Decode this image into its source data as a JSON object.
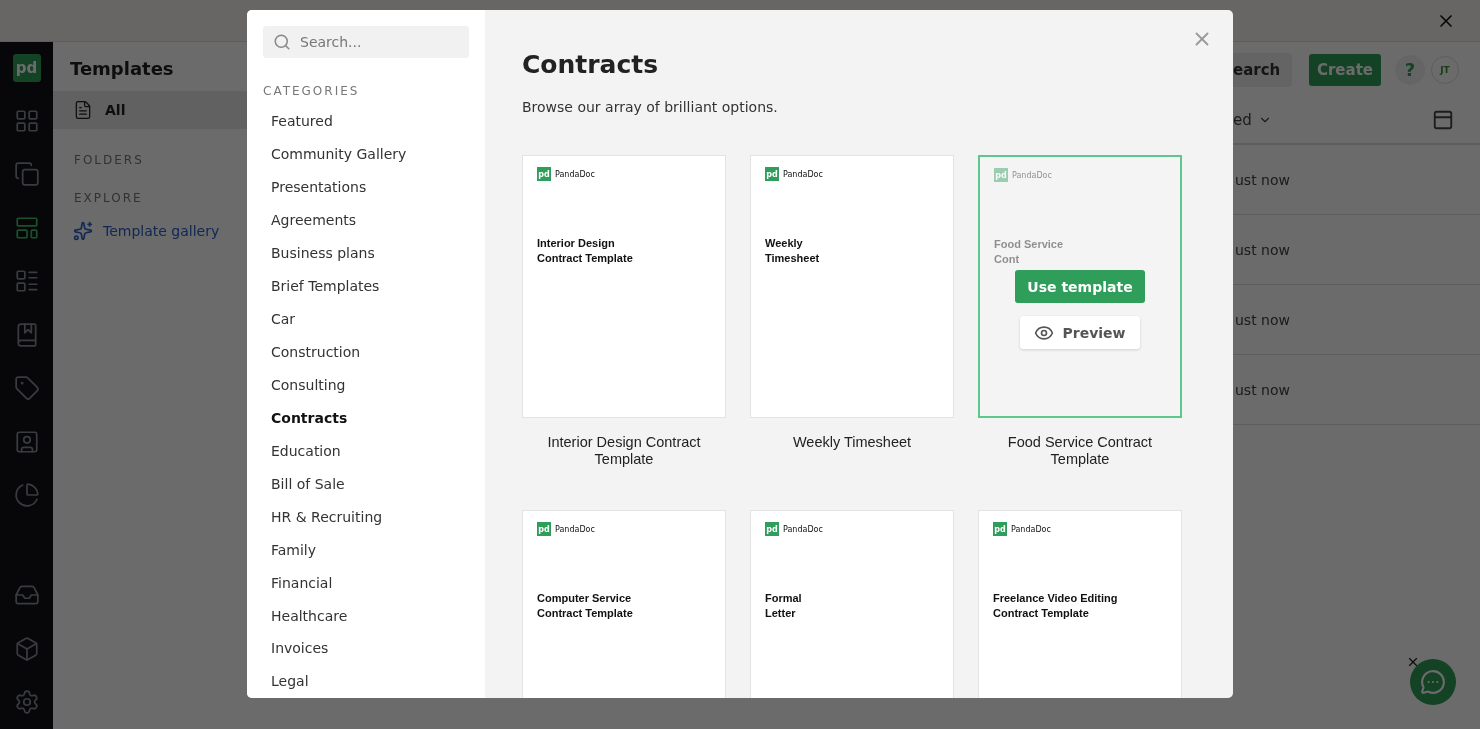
{
  "rail": {
    "logo": "pd",
    "items": [
      {
        "kind": "grid",
        "selected": false
      },
      {
        "kind": "documents",
        "selected": false
      },
      {
        "kind": "templates",
        "selected": true
      },
      {
        "kind": "layout",
        "selected": false
      },
      {
        "kind": "book",
        "selected": false
      },
      {
        "kind": "tag",
        "selected": false
      },
      {
        "kind": "contact",
        "selected": false
      },
      {
        "kind": "chart",
        "selected": false
      }
    ],
    "bottom_items": [
      {
        "kind": "inbox",
        "selected": false
      },
      {
        "kind": "cube",
        "selected": false
      },
      {
        "kind": "settings",
        "selected": false
      }
    ]
  },
  "sidebar": {
    "title": "Templates",
    "items": [
      {
        "label": "All",
        "selected": true
      }
    ],
    "sections": [
      {
        "heading": "FOLDERS"
      },
      {
        "heading": "EXPLORE",
        "links": [
          {
            "label": "Template gallery"
          }
        ]
      }
    ]
  },
  "toolbar": {
    "search_label": "earch",
    "create_label": "Create",
    "help_label": "?",
    "avatar": "JT",
    "sort_label": "ed"
  },
  "rows": [
    {
      "modified": "ust now"
    },
    {
      "modified": "ust now"
    },
    {
      "modified": "ust now"
    },
    {
      "modified": "ust now"
    }
  ],
  "modal": {
    "search_placeholder": "Search...",
    "categories_heading": "CATEGORIES",
    "categories": [
      {
        "label": "Featured",
        "selected": false
      },
      {
        "label": "Community Gallery",
        "selected": false
      },
      {
        "label": "Presentations",
        "selected": false
      },
      {
        "label": "Agreements",
        "selected": false
      },
      {
        "label": "Business plans",
        "selected": false
      },
      {
        "label": "Brief Templates",
        "selected": false
      },
      {
        "label": "Car",
        "selected": false
      },
      {
        "label": "Construction",
        "selected": false
      },
      {
        "label": "Consulting",
        "selected": false
      },
      {
        "label": "Contracts",
        "selected": true
      },
      {
        "label": "Education",
        "selected": false
      },
      {
        "label": "Bill of Sale",
        "selected": false
      },
      {
        "label": "HR & Recruiting",
        "selected": false
      },
      {
        "label": "Family",
        "selected": false
      },
      {
        "label": "Financial",
        "selected": false
      },
      {
        "label": "Healthcare",
        "selected": false
      },
      {
        "label": "Invoices",
        "selected": false
      },
      {
        "label": "Legal",
        "selected": false
      }
    ],
    "title": "Contracts",
    "subtitle": "Browse our array of brilliant options.",
    "use_label": "Use template",
    "preview_label": "Preview",
    "templates": [
      {
        "logo": "pd",
        "brand": "PandaDoc",
        "title_lines": [
          "Interior Design",
          "Contract Template"
        ],
        "hovered": false,
        "caption": "Interior Design Contract Template"
      },
      {
        "logo": "pd",
        "brand": "PandaDoc",
        "title_lines": [
          "Weekly",
          "Timesheet"
        ],
        "hovered": false,
        "caption": "Weekly Timesheet"
      },
      {
        "logo": "pd",
        "brand": "PandaDoc",
        "title_lines": [
          "Food Service",
          "Cont"
        ],
        "hovered": true,
        "caption": "Food Service Contract Template"
      },
      {
        "logo": "pd",
        "brand": "PandaDoc",
        "title_lines": [
          "Computer Service",
          "Contract Template"
        ],
        "hovered": false
      },
      {
        "logo": "pd",
        "brand": "PandaDoc",
        "title_lines": [
          "Formal",
          "Letter"
        ],
        "hovered": false
      },
      {
        "logo": "pd",
        "brand": "PandaDoc",
        "title_lines": [
          "Freelance Video Editing",
          "Contract Template"
        ],
        "hovered": false
      }
    ]
  }
}
